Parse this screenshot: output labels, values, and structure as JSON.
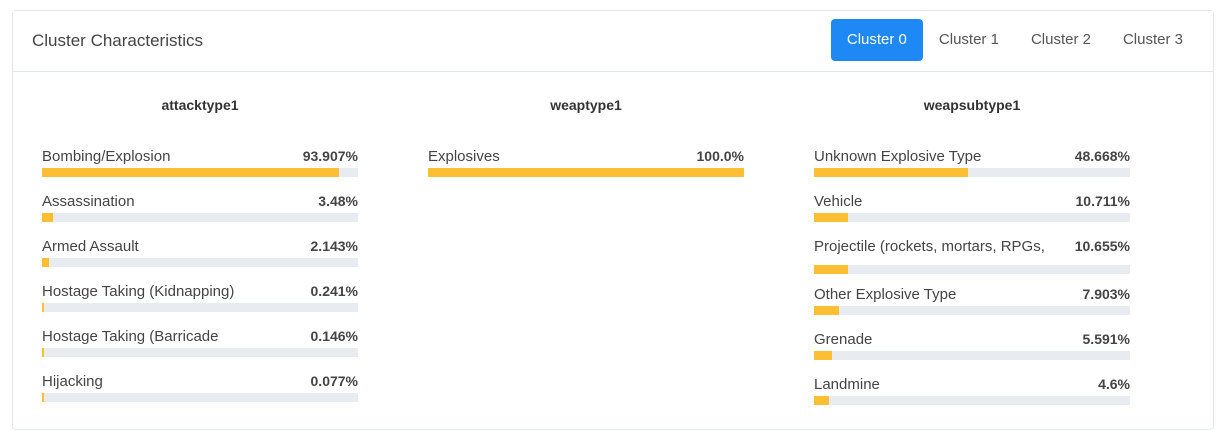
{
  "header": {
    "title": "Cluster Characteristics",
    "tabs": [
      {
        "label": "Cluster 0",
        "active": true
      },
      {
        "label": "Cluster 1",
        "active": false
      },
      {
        "label": "Cluster 2",
        "active": false
      },
      {
        "label": "Cluster 3",
        "active": false
      }
    ]
  },
  "colors": {
    "accent": "#1e88f5",
    "bar_fill": "#fcbf33",
    "bar_track": "#e8ebef"
  },
  "columns": [
    {
      "title": "attacktype1",
      "rows": [
        {
          "label": "Bombing/Explosion",
          "value": "93.907%",
          "fraction": 0.93907
        },
        {
          "label": "Assassination",
          "value": "3.48%",
          "fraction": 0.0348
        },
        {
          "label": "Armed Assault",
          "value": "2.143%",
          "fraction": 0.02143
        },
        {
          "label": "Hostage Taking (Kidnapping)",
          "value": "0.241%",
          "fraction": 0.00241
        },
        {
          "label": "Hostage Taking (Barricade",
          "value": "0.146%",
          "fraction": 0.00146
        },
        {
          "label": "Hijacking",
          "value": "0.077%",
          "fraction": 0.00077
        }
      ]
    },
    {
      "title": "weaptype1",
      "rows": [
        {
          "label": "Explosives",
          "value": "100.0%",
          "fraction": 1.0
        }
      ]
    },
    {
      "title": "weapsubtype1",
      "rows": [
        {
          "label": "Unknown Explosive Type",
          "value": "48.668%",
          "fraction": 0.48668
        },
        {
          "label": "Vehicle",
          "value": "10.711%",
          "fraction": 0.10711
        },
        {
          "label": "Projectile (rockets, mortars, RPGs,",
          "value": "10.655%",
          "fraction": 0.10655
        },
        {
          "label": "Other Explosive Type",
          "value": "7.903%",
          "fraction": 0.07903
        },
        {
          "label": "Grenade",
          "value": "5.591%",
          "fraction": 0.05591
        },
        {
          "label": "Landmine",
          "value": "4.6%",
          "fraction": 0.046
        }
      ]
    }
  ]
}
